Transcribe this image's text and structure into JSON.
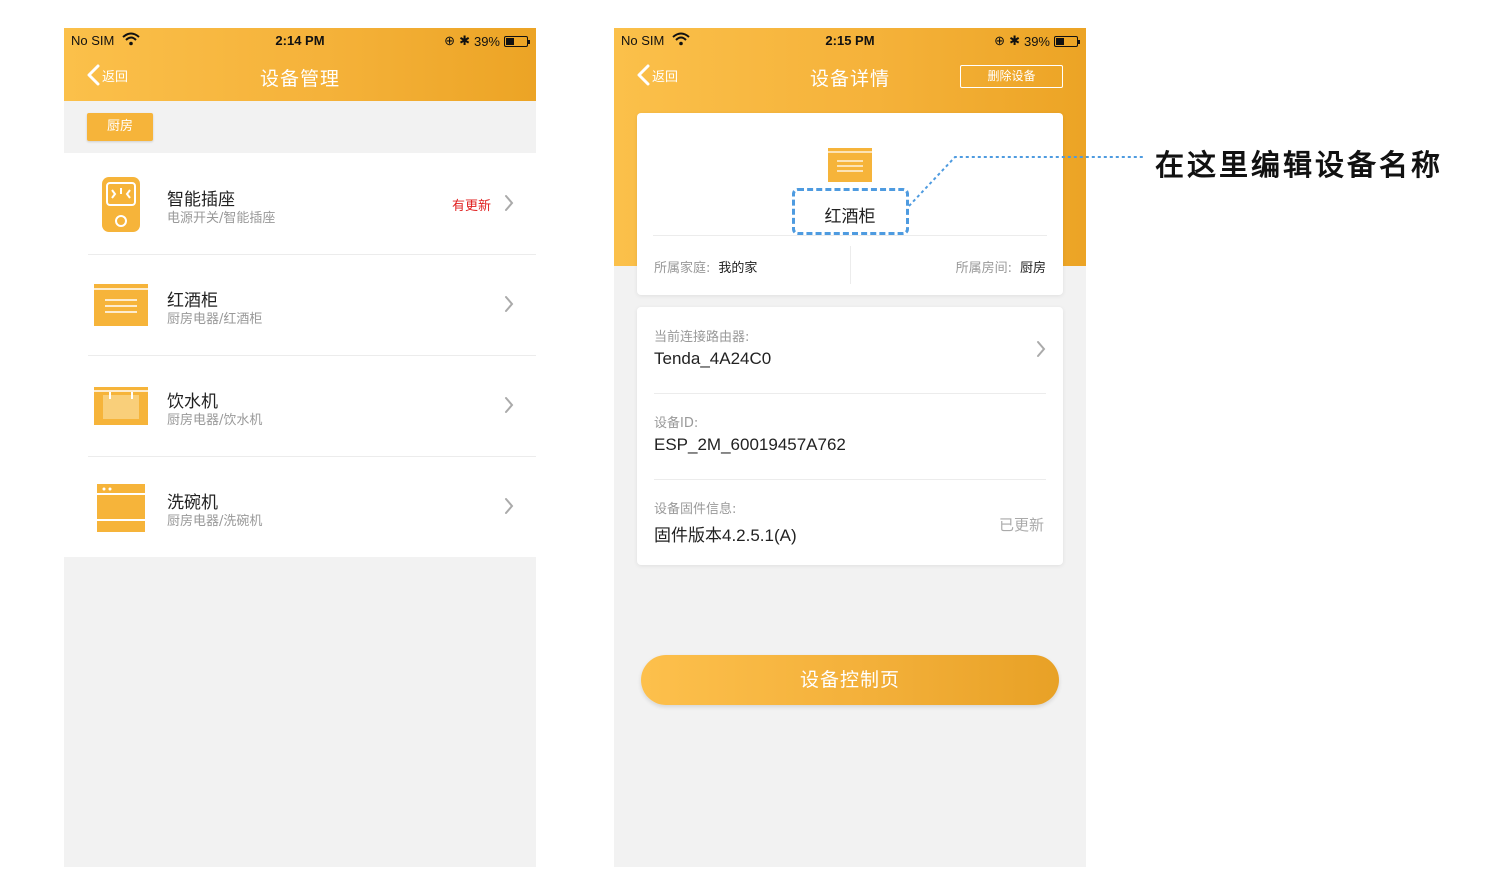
{
  "left_screen": {
    "status": {
      "carrier": "No SIM",
      "time": "2:14 PM",
      "battery": "39%"
    },
    "nav": {
      "back_label": "返回",
      "title": "设备管理"
    },
    "room_tag": "厨房",
    "devices": [
      {
        "name": "智能插座",
        "subtitle": "电源开关/智能插座",
        "badge": "有更新",
        "icon": "smart-plug-icon"
      },
      {
        "name": "红酒柜",
        "subtitle": "厨房电器/红酒柜",
        "badge": "",
        "icon": "wine-cabinet-icon"
      },
      {
        "name": "饮水机",
        "subtitle": "厨房电器/饮水机",
        "badge": "",
        "icon": "water-dispenser-icon"
      },
      {
        "name": "洗碗机",
        "subtitle": "厨房电器/洗碗机",
        "badge": "",
        "icon": "dishwasher-icon"
      }
    ]
  },
  "right_screen": {
    "status": {
      "carrier": "No SIM",
      "time": "2:15 PM",
      "battery": "39%"
    },
    "nav": {
      "back_label": "返回",
      "title": "设备详情",
      "delete_label": "删除设备"
    },
    "device_card": {
      "name": "红酒柜",
      "home_label": "所属家庭:",
      "home_value": "我的家",
      "room_label": "所属房间:",
      "room_value": "厨房"
    },
    "info": {
      "router_label": "当前连接路由器:",
      "router_value": "Tenda_4A24C0",
      "id_label": "设备ID:",
      "id_value": "ESP_2M_60019457A762",
      "firmware_label": "设备固件信息:",
      "firmware_value": "固件版本4.2.5.1(A)",
      "firmware_status": "已更新"
    },
    "control_button": "设备控制页"
  },
  "annotation": "在这里编辑设备名称",
  "colors": {
    "accent": "#f5b23a",
    "badge_red": "#e02020",
    "callout_blue": "#4e9be0"
  }
}
